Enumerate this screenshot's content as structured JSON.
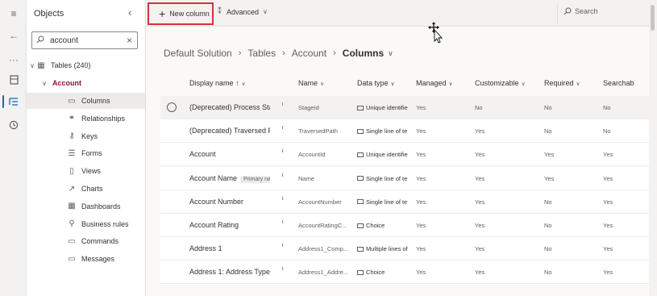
{
  "objects_pane": {
    "title": "Objects",
    "search_value": "account",
    "tables_label": "Tables (240)",
    "account_label": "Account",
    "items": [
      {
        "label": "Columns",
        "icon": "columns-icon",
        "glyph": "▭"
      },
      {
        "label": "Relationships",
        "icon": "relationships-icon",
        "glyph": "⚭"
      },
      {
        "label": "Keys",
        "icon": "keys-icon",
        "glyph": "⚷"
      },
      {
        "label": "Forms",
        "icon": "forms-icon",
        "glyph": "☰"
      },
      {
        "label": "Views",
        "icon": "views-icon",
        "glyph": "▯"
      },
      {
        "label": "Charts",
        "icon": "charts-icon",
        "glyph": "↗"
      },
      {
        "label": "Dashboards",
        "icon": "dashboards-icon",
        "glyph": "▦"
      },
      {
        "label": "Business rules",
        "icon": "business-rules-icon",
        "glyph": "⚲"
      },
      {
        "label": "Commands",
        "icon": "commands-icon",
        "glyph": "▭"
      },
      {
        "label": "Messages",
        "icon": "messages-icon",
        "glyph": "▭"
      }
    ]
  },
  "cmdbar": {
    "new_column": "New column",
    "advanced": "Advanced",
    "search": "Search"
  },
  "breadcrumb": {
    "items": [
      "Default Solution",
      "Tables",
      "Account"
    ],
    "current": "Columns"
  },
  "grid": {
    "headers": {
      "display_name": "Display name ↑",
      "name": "Name",
      "data_type": "Data type",
      "managed": "Managed",
      "customizable": "Customizable",
      "required": "Required",
      "searchable": "Searchab"
    },
    "rows": [
      {
        "display": "(Deprecated) Process Stag",
        "pill": "",
        "name": "StageId",
        "type": "Unique identifie",
        "managed": "Yes",
        "customizable": "No",
        "required": "No",
        "searchable": "No"
      },
      {
        "display": "(Deprecated) Traversed Pa",
        "pill": "",
        "name": "TraversedPath",
        "type": "Single line of te",
        "managed": "Yes",
        "customizable": "Yes",
        "required": "No",
        "searchable": "No"
      },
      {
        "display": "Account",
        "pill": "",
        "name": "AccountId",
        "type": "Unique identifie",
        "managed": "Yes",
        "customizable": "Yes",
        "required": "Yes",
        "searchable": "Yes"
      },
      {
        "display": "Account Name",
        "pill": "Primary na",
        "name": "Name",
        "type": "Single line of te",
        "managed": "Yes",
        "customizable": "Yes",
        "required": "Yes",
        "searchable": "Yes"
      },
      {
        "display": "Account Number",
        "pill": "",
        "name": "AccountNumber",
        "type": "Single line of te",
        "managed": "Yes",
        "customizable": "Yes",
        "required": "No",
        "searchable": "Yes"
      },
      {
        "display": "Account Rating",
        "pill": "",
        "name": "AccountRatingC...",
        "type": "Choice",
        "managed": "Yes",
        "customizable": "Yes",
        "required": "No",
        "searchable": "Yes"
      },
      {
        "display": "Address 1",
        "pill": "",
        "name": "Address1_Comp...",
        "type": "Multiple lines of",
        "managed": "Yes",
        "customizable": "Yes",
        "required": "No",
        "searchable": "Yes"
      },
      {
        "display": "Address 1: Address Type",
        "pill": "",
        "name": "Address1_Addre...",
        "type": "Choice",
        "managed": "Yes",
        "customizable": "Yes",
        "required": "No",
        "searchable": "Yes"
      }
    ]
  }
}
